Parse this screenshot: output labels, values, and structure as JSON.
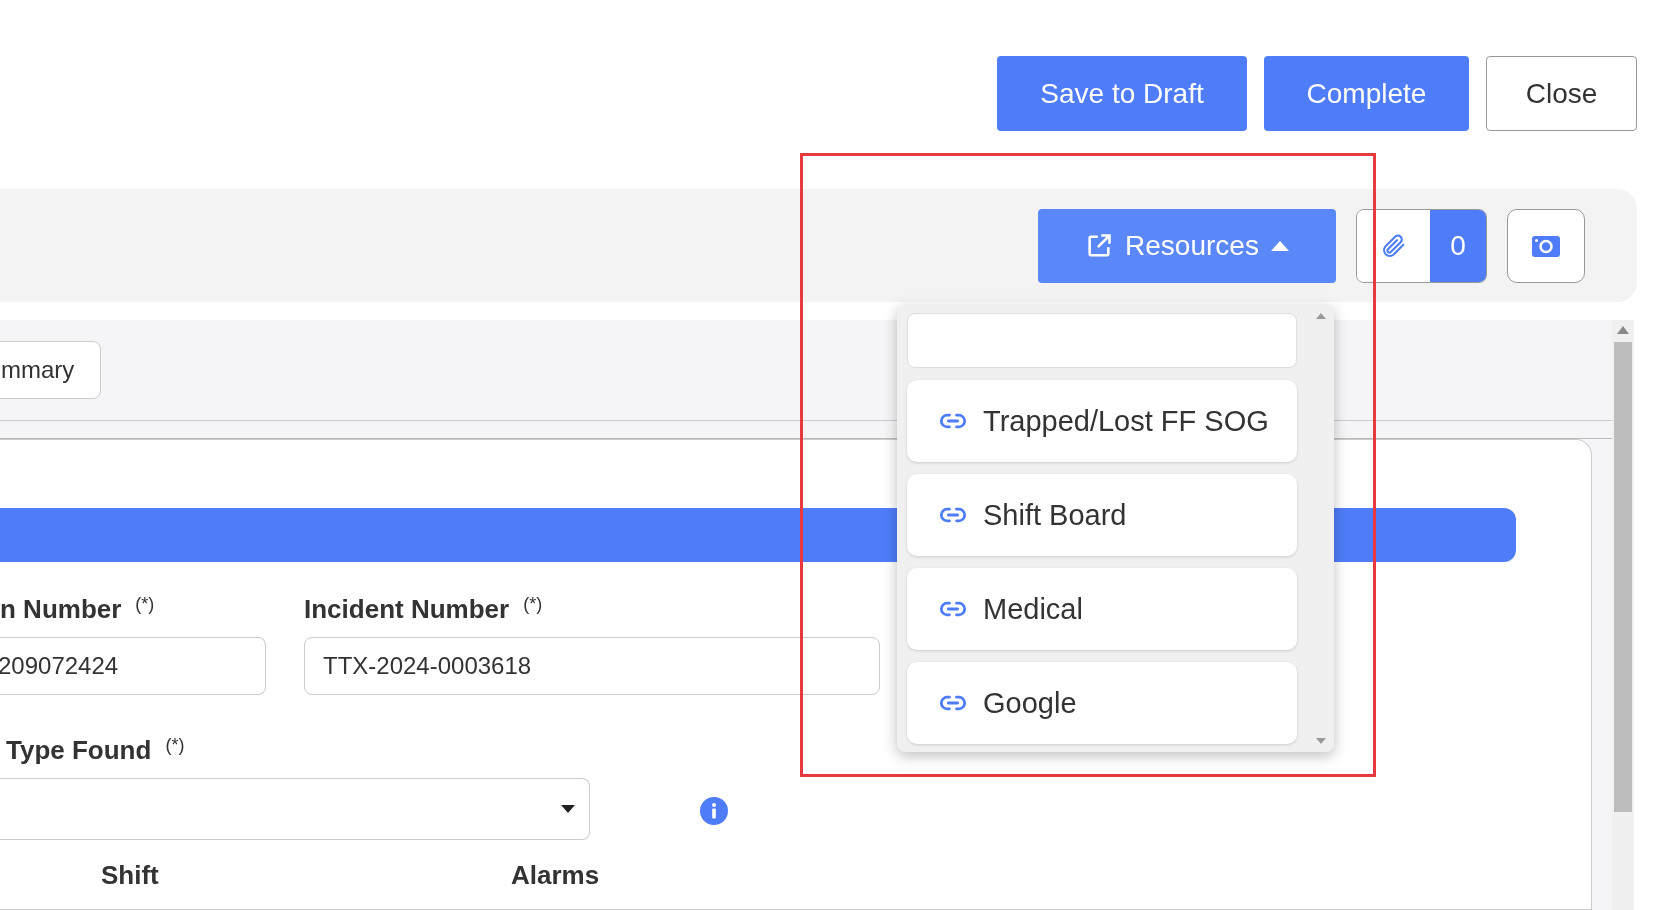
{
  "actions": [
    {
      "label": "Save to Draft",
      "kind": "primary"
    },
    {
      "label": "Complete",
      "kind": "primary"
    },
    {
      "label": "Close",
      "kind": "outline"
    }
  ],
  "toolbar": {
    "resources_button": {
      "label": "Resources",
      "expanded": true
    },
    "attachments": {
      "count": "0"
    }
  },
  "resources_menu": {
    "items": [
      {
        "label": "Trapped/Lost FF SOG"
      },
      {
        "label": "Shift Board"
      },
      {
        "label": "Medical"
      },
      {
        "label": "Google"
      }
    ]
  },
  "section_tabs": [
    {
      "label": "mmary"
    }
  ],
  "form": {
    "fields": [
      {
        "label": "n Number",
        "required_mark": "(*)",
        "value": "209072424"
      },
      {
        "label": "Incident Number",
        "required_mark": "(*)",
        "value": "TTX-2024-0003618"
      }
    ],
    "select_field": {
      "label": "Type Found",
      "required_mark": "(*)"
    },
    "columns": [
      "Shift",
      "Alarms"
    ]
  }
}
